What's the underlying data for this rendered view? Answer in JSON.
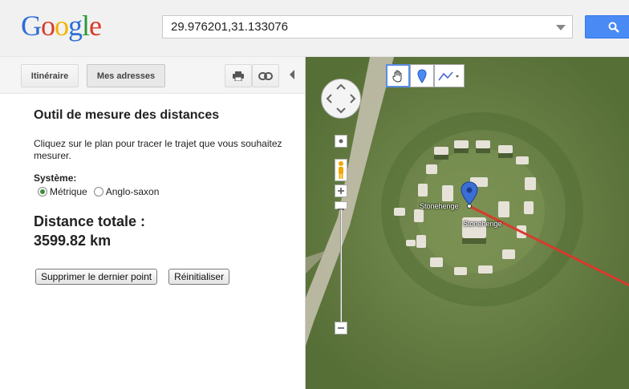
{
  "header": {
    "logo_letters": [
      "G",
      "o",
      "o",
      "g",
      "l",
      "e"
    ],
    "logo_colors": [
      "#2f6fd6",
      "#d93a2b",
      "#f1b400",
      "#2f6fd6",
      "#2a9a37",
      "#d93a2b"
    ],
    "search_value": "29.976201,31.133076"
  },
  "toolbar": {
    "itinerary_label": "Itinéraire",
    "my_places_label": "Mes adresses"
  },
  "panel": {
    "title": "Outil de mesure des distances",
    "description": "Cliquez sur le plan pour tracer le trajet que vous souhaitez mesurer.",
    "system_label": "Système:",
    "metric_label": "Métrique",
    "imperial_label": "Anglo-saxon",
    "total_label": "Distance totale :",
    "total_value": "3599.82 km",
    "remove_last_label": "Supprimer le dernier point",
    "reset_label": "Réinitialiser"
  },
  "map": {
    "pin_label_1": "Stonehenge",
    "pin_label_2": "Stonehenge",
    "accent_color": "#d83a2c"
  }
}
